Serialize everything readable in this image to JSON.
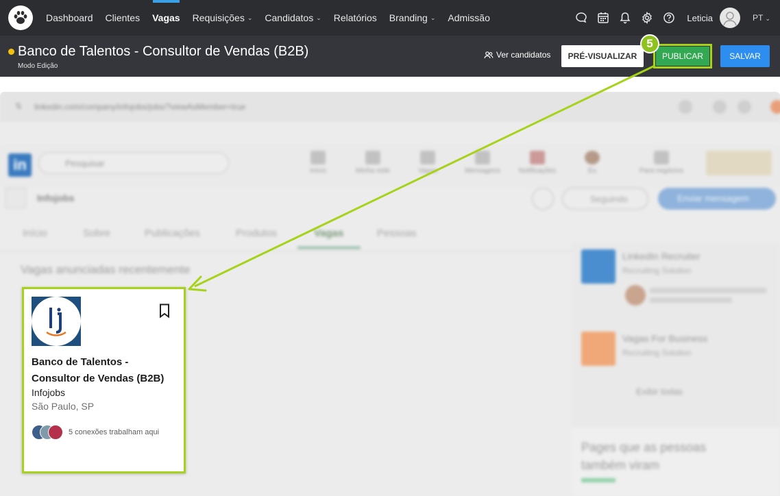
{
  "nav": {
    "items": [
      {
        "label": "Dashboard",
        "caret": false,
        "active": false
      },
      {
        "label": "Clientes",
        "caret": false,
        "active": false
      },
      {
        "label": "Vagas",
        "caret": false,
        "active": true
      },
      {
        "label": "Requisições",
        "caret": true,
        "active": false
      },
      {
        "label": "Candidatos",
        "caret": true,
        "active": false
      },
      {
        "label": "Relatórios",
        "caret": false,
        "active": false
      },
      {
        "label": "Branding",
        "caret": true,
        "active": false
      },
      {
        "label": "Admissão",
        "caret": false,
        "active": false
      }
    ],
    "icons": [
      "chat-icon",
      "calendar-icon",
      "bell-icon",
      "gear-icon",
      "help-icon"
    ],
    "user": "Leticia",
    "lang": "PT",
    "active_color": "#3ba0e6"
  },
  "subheader": {
    "title": "Banco de Talentos - Consultor de Vendas (B2B)",
    "mode": "Modo Edição",
    "view_candidates": "Ver candidatos",
    "preview": "PRÉ-VISUALIZAR",
    "publish": "PUBLICAR",
    "save": "SALVAR",
    "status_color": "#f4c20d",
    "publish_color": "#33a852",
    "save_color": "#2d8ef0",
    "highlight_color": "#a6d21a"
  },
  "tutorial": {
    "step": "5"
  },
  "browser": {
    "url": "linkedin.com/company/infojobs/jobs/?viewAsMember=true",
    "search_placeholder": "Pesquisar",
    "nav_items": [
      "Início",
      "Minha rede",
      "Vagas",
      "Mensagens",
      "Notificações",
      "Eu",
      "Para negócios"
    ],
    "company": "Infojobs",
    "follow_label": "Seguindo",
    "message_label": "Enviar mensagem",
    "tabs": [
      "Início",
      "Sobre",
      "Publicações",
      "Produtos",
      "Vagas",
      "Pessoas"
    ],
    "active_tab": "Vagas",
    "section_title": "Vagas anunciadas recentemente",
    "side_items": [
      {
        "title": "LinkedIn Recruiter",
        "sub": "Recruiting Solution"
      },
      {
        "title": "Vagas For Business",
        "sub": "Recruiting Solution"
      }
    ],
    "side_footer": "Exibir todas",
    "side_block_title": "Pages que as pessoas também viram"
  },
  "card": {
    "title": "Banco de Talentos - Consultor de Vendas (B2B)",
    "company": "Infojobs",
    "location": "São Paulo, SP",
    "connections": "5 conexões trabalham aqui",
    "logo_text": "lj"
  }
}
